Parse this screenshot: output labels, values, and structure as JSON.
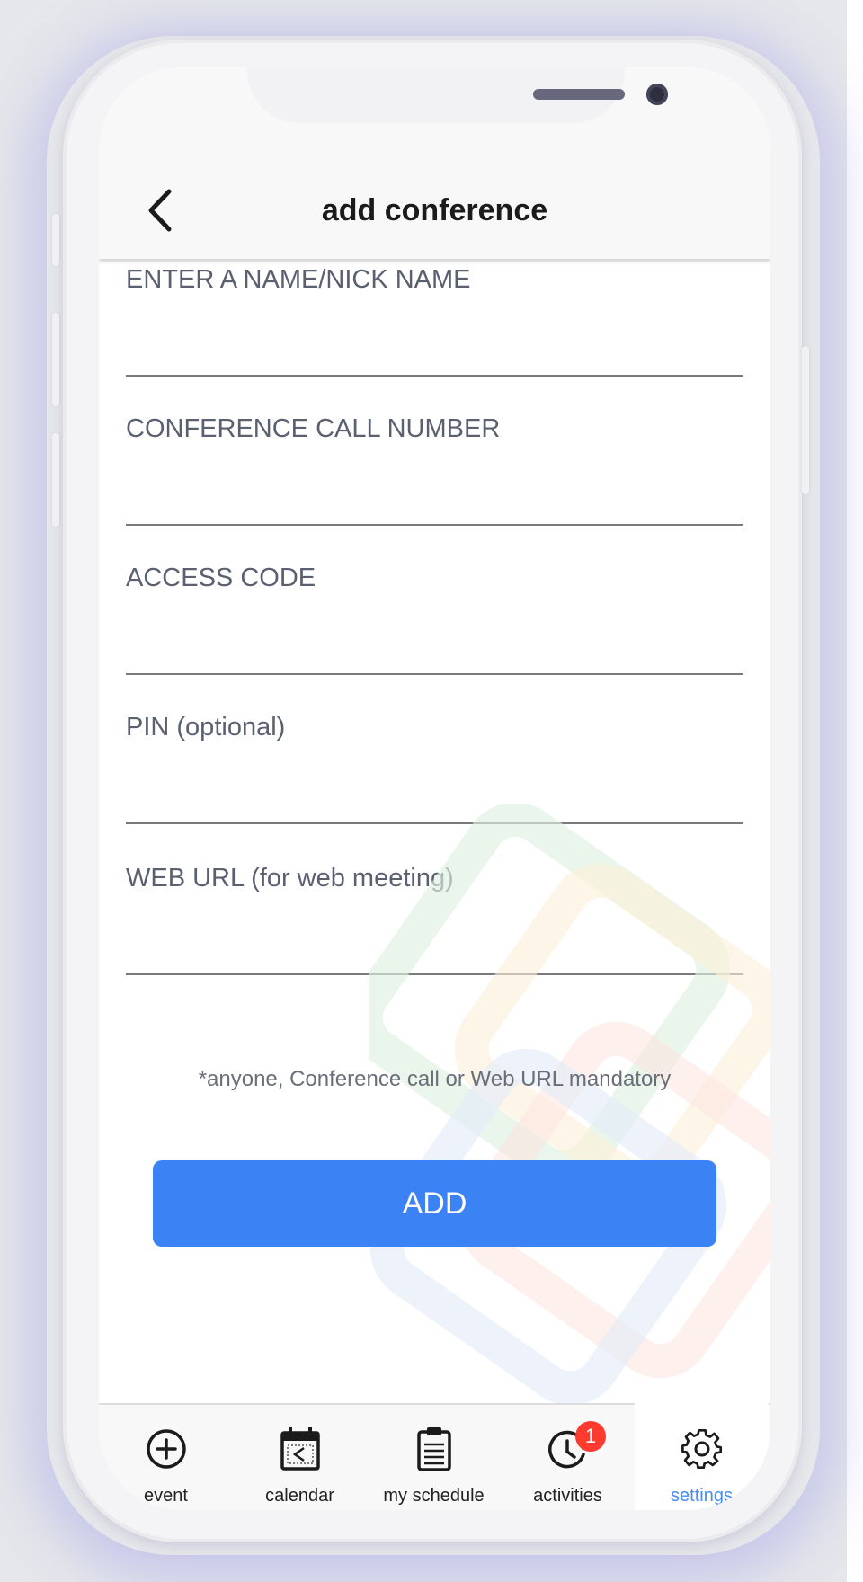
{
  "header": {
    "title": "add conference",
    "back_icon": "chevron-left-icon"
  },
  "form": {
    "fields": [
      {
        "label": "ENTER A NAME/NICK NAME",
        "value": ""
      },
      {
        "label": "CONFERENCE CALL NUMBER",
        "value": ""
      },
      {
        "label": "ACCESS CODE",
        "value": ""
      },
      {
        "label": "PIN (optional)",
        "value": ""
      },
      {
        "label": "WEB URL (for web meeting)",
        "value": ""
      }
    ],
    "note": "*anyone, Conference call or Web URL mandatory",
    "submit_label": "ADD"
  },
  "tabbar": {
    "tabs": [
      {
        "label": "event",
        "icon": "plus-circle-icon",
        "active": false
      },
      {
        "label": "calendar",
        "icon": "calendar-icon",
        "active": false
      },
      {
        "label": "my schedule",
        "icon": "clipboard-icon",
        "active": false
      },
      {
        "label": "activities",
        "icon": "clock-icon",
        "active": false,
        "badge": "1"
      },
      {
        "label": "settings",
        "icon": "gear-icon",
        "active": true
      }
    ]
  },
  "colors": {
    "accent": "#3b82f5",
    "active_tab": "#4a8cf0",
    "badge": "#ff3b30"
  }
}
